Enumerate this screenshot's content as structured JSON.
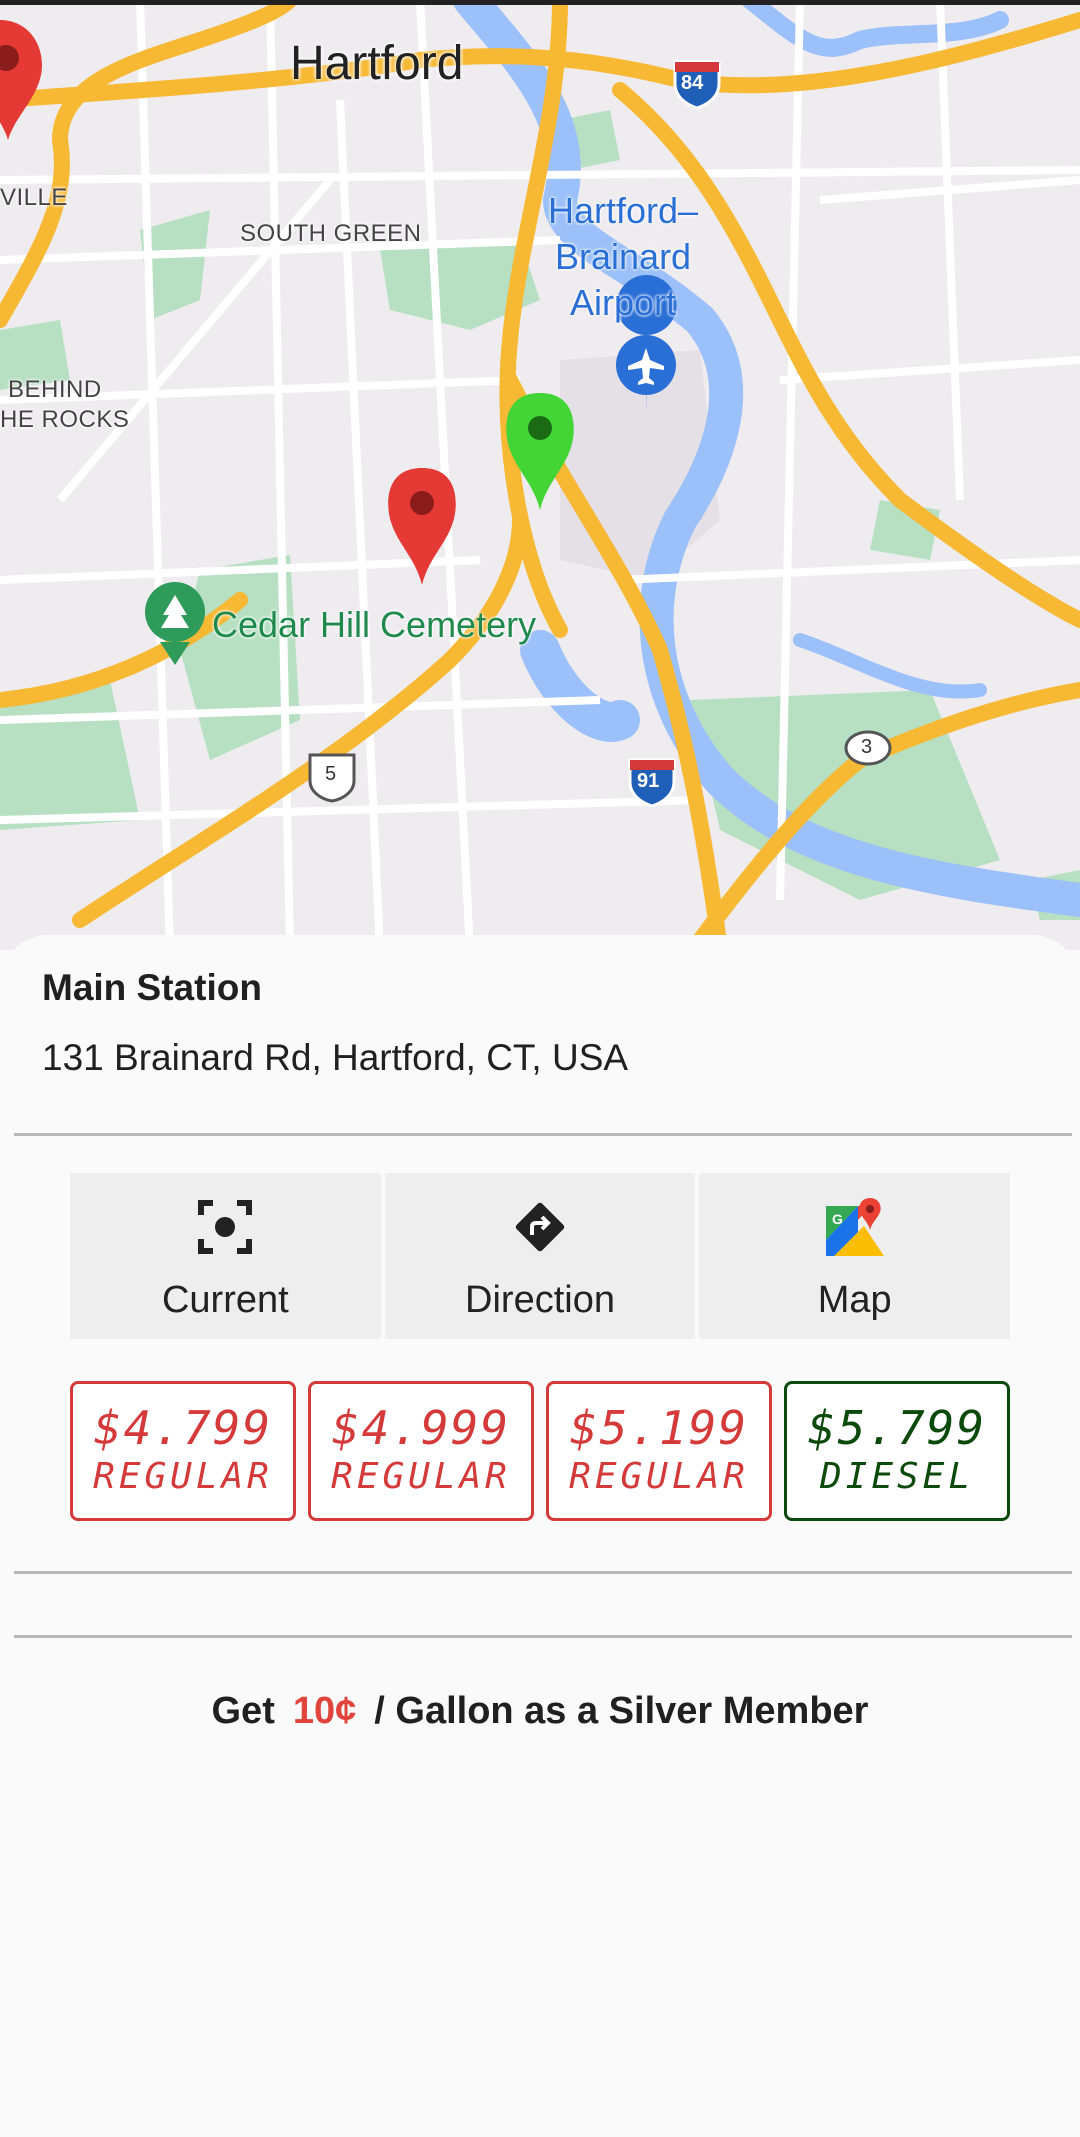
{
  "map": {
    "labels": {
      "city": "Hartford",
      "south_green": "SOUTH GREEN",
      "ville": "VILLE",
      "behind_rocks_1": "BEHIND",
      "behind_rocks_2": "HE ROCKS",
      "airport": "Hartford–\nBrainard\nAirport",
      "cemetery": "Cedar Hill Cemetery",
      "shield_84": "84",
      "shield_91": "91",
      "shield_5": "5",
      "shield_3": "3"
    },
    "markers": [
      {
        "color": "#e53935",
        "label": "red-marker-left-edge"
      },
      {
        "color": "#e53935",
        "label": "red-marker"
      },
      {
        "color": "#43d436",
        "label": "green-marker-selected"
      }
    ],
    "colors": {
      "road": "#f7b833",
      "water": "#9cc0f9",
      "park": "#b7e0c3",
      "land": "#efecf0"
    }
  },
  "station": {
    "name": "Main Station",
    "address": "131 Brainard Rd, Hartford, CT, USA"
  },
  "actions": [
    {
      "label": "Current",
      "icon": "crosshair-icon"
    },
    {
      "label": "Direction",
      "icon": "directions-icon"
    },
    {
      "label": "Map",
      "icon": "google-maps-icon"
    }
  ],
  "prices": [
    {
      "amount": "$4.799",
      "grade": "REGULAR",
      "color": "#d53a3a"
    },
    {
      "amount": "$4.999",
      "grade": "REGULAR",
      "color": "#d53a3a"
    },
    {
      "amount": "$5.199",
      "grade": "REGULAR",
      "color": "#d53a3a"
    },
    {
      "amount": "$5.799",
      "grade": "DIESEL",
      "color": "#0c4a0c"
    }
  ],
  "promo": {
    "prefix": "Get",
    "highlight": "10¢",
    "suffix": "/ Gallon as a Silver Member"
  }
}
